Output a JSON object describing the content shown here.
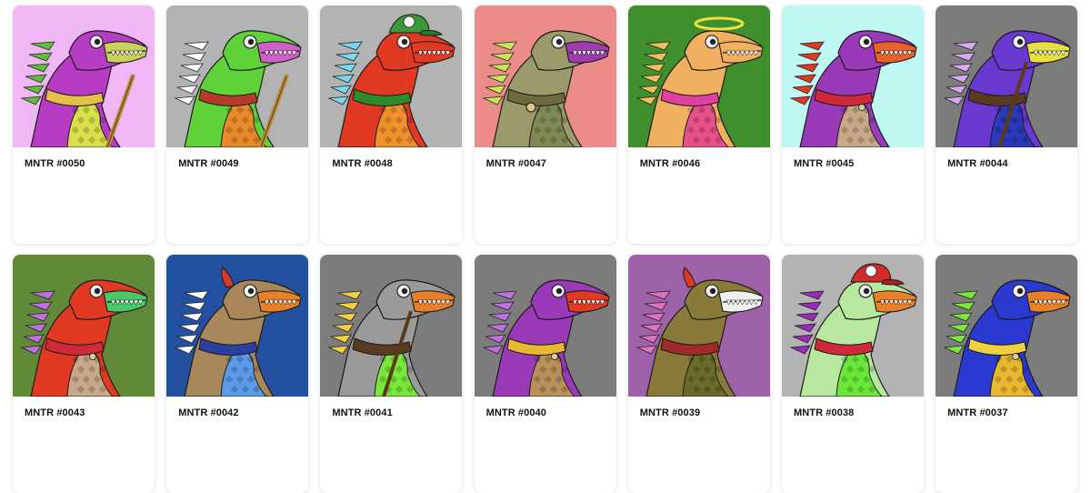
{
  "gallery": {
    "items": [
      {
        "name": "MNTR #0050",
        "background": "#f0b6f6",
        "skin": "#b73cc4",
        "pattern": "#d8e04a",
        "snout": "#c8d25a",
        "crest": "#5fbf3a",
        "scarf": "#e2c04a",
        "accessory": "stick-icon"
      },
      {
        "name": "MNTR #0049",
        "background": "#b3b3b3",
        "skin": "#5fd23a",
        "pattern": "#e88a2a",
        "snout": "#d060c8",
        "crest": "#ffffff",
        "scarf": "#b53a28",
        "accessory": "stick-icon"
      },
      {
        "name": "MNTR #0048",
        "background": "#b3b3b3",
        "skin": "#e23a22",
        "pattern": "#f0902a",
        "snout": "#e23a22",
        "crest": "#7ad8f0",
        "scarf": "#2f8a2a",
        "accessory": "cap-icon"
      },
      {
        "name": "MNTR #0047",
        "background": "#ec8c88",
        "skin": "#9a9a6a",
        "pattern": "#7f8a52",
        "snout": "#a03ab0",
        "crest": "#c8e85a",
        "scarf": "#6d6a40",
        "accessory": "pendant-icon"
      },
      {
        "name": "MNTR #0046",
        "background": "#3f8f2c",
        "skin": "#f0b060",
        "pattern": "#e8508a",
        "snout": "#f0b060",
        "crest": "#f0c060",
        "scarf": "#e040a0",
        "accessory": "halo-icon"
      },
      {
        "name": "MNTR #0045",
        "background": "#bff7f2",
        "skin": "#9a3ab8",
        "pattern": "#c8a888",
        "snout": "#e8602a",
        "crest": "#e23a22",
        "scarf": "#d02a3a",
        "accessory": "collar-icon"
      },
      {
        "name": "MNTR #0044",
        "background": "#7c7c7c",
        "skin": "#6a3ad0",
        "pattern": "#2a3ab8",
        "snout": "#e8e040",
        "crest": "#d8a8f0",
        "scarf": "#5a3a20",
        "accessory": "strap-icon"
      },
      {
        "name": "MNTR #0043",
        "background": "#608a38",
        "skin": "#e23a22",
        "pattern": "#c8a888",
        "snout": "#4ac86a",
        "crest": "#c070e0",
        "scarf": "#d02a3a",
        "accessory": "collar-icon"
      },
      {
        "name": "MNTR #0042",
        "background": "#2450a0",
        "skin": "#a8885a",
        "pattern": "#5a9ae8",
        "snout": "#e8802a",
        "crest": "#ffffff",
        "scarf": "#2a40a0",
        "accessory": "horn-icon"
      },
      {
        "name": "MNTR #0041",
        "background": "#7c7c7c",
        "skin": "#9a9a9a",
        "pattern": "#7ae83a",
        "snout": "#e8802a",
        "crest": "#f0d040",
        "scarf": "#5a3a20",
        "accessory": "strap-icon"
      },
      {
        "name": "MNTR #0040",
        "background": "#7c7c7c",
        "skin": "#9a3ab8",
        "pattern": "#b8905a",
        "snout": "#e23a22",
        "crest": "#c070e0",
        "scarf": "#e8b830",
        "accessory": "collar-icon"
      },
      {
        "name": "MNTR #0039",
        "background": "#9e62a8",
        "skin": "#8a7a3a",
        "pattern": "#6a6a2a",
        "snout": "#f0f0f0",
        "crest": "#e070c0",
        "scarf": "#a02a2a",
        "accessory": "horn-icon"
      },
      {
        "name": "MNTR #0038",
        "background": "#b3b3b3",
        "skin": "#b8e8a0",
        "pattern": "#6ae83a",
        "snout": "#e8802a",
        "crest": "#9a2ab8",
        "scarf": "#d02a3a",
        "accessory": "cap-icon"
      },
      {
        "name": "MNTR #0037",
        "background": "#7c7c7c",
        "skin": "#2a3ad0",
        "pattern": "#e8b830",
        "snout": "#e8802a",
        "crest": "#7ae83a",
        "scarf": "#f0d040",
        "accessory": "collar-icon"
      }
    ]
  }
}
